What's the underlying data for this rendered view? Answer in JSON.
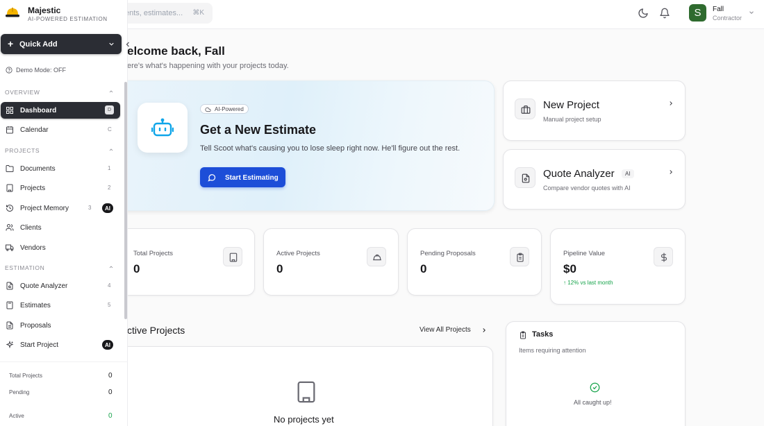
{
  "app": {
    "name": "Majestic",
    "tagline": "AI-POWERED ESTIMATION"
  },
  "search": {
    "placeholder": "ents, estimates...",
    "shortcut": "⌘K"
  },
  "user": {
    "initial": "S",
    "name": "Fall",
    "role": "Contractor"
  },
  "sidebar": {
    "quick_add": "Quick Add",
    "demo_mode": "Demo Mode: OFF",
    "sections": {
      "overview": "OVERVIEW",
      "projects": "PROJECTS",
      "estimation": "ESTIMATION"
    },
    "items": {
      "dashboard": {
        "label": "Dashboard",
        "shortcut": "D"
      },
      "calendar": {
        "label": "Calendar",
        "count": "C"
      },
      "documents": {
        "label": "Documents",
        "count": "1"
      },
      "projects": {
        "label": "Projects",
        "count": "2"
      },
      "project_memory": {
        "label": "Project Memory",
        "count": "3",
        "badge": "AI"
      },
      "clients": {
        "label": "Clients"
      },
      "vendors": {
        "label": "Vendors"
      },
      "quote_analyzer": {
        "label": "Quote Analyzer",
        "count": "4"
      },
      "estimates": {
        "label": "Estimates",
        "count": "5"
      },
      "proposals": {
        "label": "Proposals"
      },
      "start_project": {
        "label": "Start Project",
        "badge": "AI"
      }
    },
    "stats": [
      {
        "label": "Total Projects",
        "value": "0"
      },
      {
        "label": "Pending",
        "value": "0"
      },
      {
        "label": "Active",
        "value": "0"
      }
    ]
  },
  "main": {
    "welcome": "elcome back, Fall",
    "welcome_sub": "ere's what's happening with your projects today.",
    "hero": {
      "chip": "AI-Powered",
      "title": "Get a New Estimate",
      "desc": "Tell Scoot what's causing you to lose sleep right now. He'll figure out the rest.",
      "button": "Start Estimating"
    },
    "actions": {
      "new_project": {
        "title": "New Project",
        "sub": "Manual project setup"
      },
      "quote_analyzer": {
        "title": "Quote Analyzer",
        "badge": "AI",
        "sub": "Compare vendor quotes with AI"
      }
    },
    "stats": {
      "total": {
        "label": "Total Projects",
        "value": "0"
      },
      "active": {
        "label": "Active Projects",
        "value": "0"
      },
      "pending": {
        "label": "Pending Proposals",
        "value": "0"
      },
      "pipeline": {
        "label": "Pipeline Value",
        "value": "$0",
        "trend": "↑ 12% vs last month"
      }
    },
    "active_projects": {
      "title": "ctive Projects",
      "view_all": "View All Projects",
      "empty": "No projects yet"
    },
    "tasks": {
      "title": "Tasks",
      "sub": "Items requiring attention",
      "empty": "All caught up!"
    }
  },
  "colors": {
    "primary": "#1d4ed8",
    "sidebar_active": "#2b2d34",
    "success": "#16a34a",
    "avatar": "#2f6b2f"
  }
}
